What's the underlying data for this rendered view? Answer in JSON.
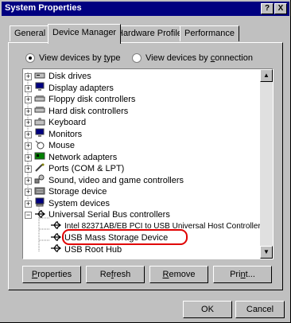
{
  "window": {
    "title": "System Properties",
    "help": "?",
    "close": "X"
  },
  "tabs": [
    {
      "label": "General"
    },
    {
      "label": "Device Manager"
    },
    {
      "label": "Hardware Profiles"
    },
    {
      "label": "Performance"
    }
  ],
  "view": {
    "by_type": {
      "pre": "View devices by ",
      "hot": "t",
      "post": "ype",
      "selected": true
    },
    "by_connection": {
      "pre": "View devices by ",
      "hot": "c",
      "post": "onnection",
      "selected": false
    }
  },
  "tree": {
    "items": [
      {
        "label": "Disk drives",
        "icon": "disk-drive-icon"
      },
      {
        "label": "Display adapters",
        "icon": "monitor-icon"
      },
      {
        "label": "Floppy disk controllers",
        "icon": "controller-icon"
      },
      {
        "label": "Hard disk controllers",
        "icon": "controller-icon"
      },
      {
        "label": "Keyboard",
        "icon": "keyboard-icon"
      },
      {
        "label": "Monitors",
        "icon": "monitor-icon"
      },
      {
        "label": "Mouse",
        "icon": "mouse-icon"
      },
      {
        "label": "Network adapters",
        "icon": "network-card-icon"
      },
      {
        "label": "Ports (COM & LPT)",
        "icon": "port-icon"
      },
      {
        "label": "Sound, video and game controllers",
        "icon": "sound-icon"
      },
      {
        "label": "Storage device",
        "icon": "storage-icon"
      },
      {
        "label": "System devices",
        "icon": "computer-icon"
      },
      {
        "label": "Universal Serial Bus controllers",
        "icon": "usb-icon",
        "expanded": true
      }
    ],
    "children": [
      {
        "label": "Intel 82371AB/EB PCI to USB Universal Host Controller",
        "icon": "usb-icon"
      },
      {
        "label": "USB Mass Storage Device",
        "icon": "usb-icon",
        "circled": true
      },
      {
        "label": "USB Root Hub",
        "icon": "usb-icon"
      }
    ]
  },
  "buttons": {
    "properties": {
      "hot": "P",
      "rest": "roperties"
    },
    "refresh": {
      "pre": "Re",
      "hot": "f",
      "post": "resh"
    },
    "remove": {
      "hot": "R",
      "post": "emove"
    },
    "print": {
      "pre": "Pri",
      "hot": "n",
      "post": "t..."
    },
    "ok": "OK",
    "cancel": "Cancel"
  },
  "colors": {
    "titlebar": "#000080",
    "highlight_circle": "#e00000",
    "face": "#c0c0c0"
  }
}
